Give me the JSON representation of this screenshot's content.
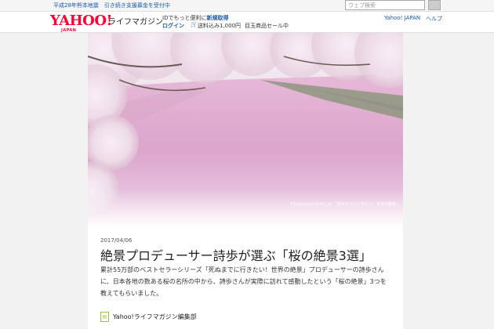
{
  "notice": {
    "text": "平成28年熊本地震　引き続き支援募金を受付中"
  },
  "header": {
    "logo": {
      "brand": "YAHOO!",
      "sub": "JAPAN",
      "service": "ライフマガジン"
    },
    "promo": {
      "prefix": "IDでもっと便利に",
      "highlight": "新規取得"
    },
    "login_label": "ログイン",
    "cart_icon": "cart-icon",
    "shipping_text": "送料込み1,000円",
    "sale_label": "目玉商品セール中",
    "search": {
      "placeholder": "ウェブ検索"
    },
    "links": {
      "yahoo_japan": "Yahoo! JAPAN",
      "help": "ヘルプ"
    }
  },
  "hero": {
    "credit": "©Instagram/shiho_jp　「死ぬまでに行きたい！世界の絶景」"
  },
  "article": {
    "date": "2017/04/06",
    "title": "絶景プロデューサー詩歩が選ぶ「桜の絶景3選」",
    "lead": "累計55万部のベストセラーシリーズ「死ぬまでに行きたい！世界の絶景」プロデューサーの詩歩さんに、日本各地の数ある桜の名所の中から、詩歩さんが実際に訪れて感動したという「桜の絶景」3つを教えてもらいました。",
    "author": "Yahoo!ライフマガジン編集部"
  },
  "colors": {
    "brand_red": "#ff0033",
    "link_blue": "#1b5aa8",
    "sakura_pink": "#e8b8d6"
  }
}
